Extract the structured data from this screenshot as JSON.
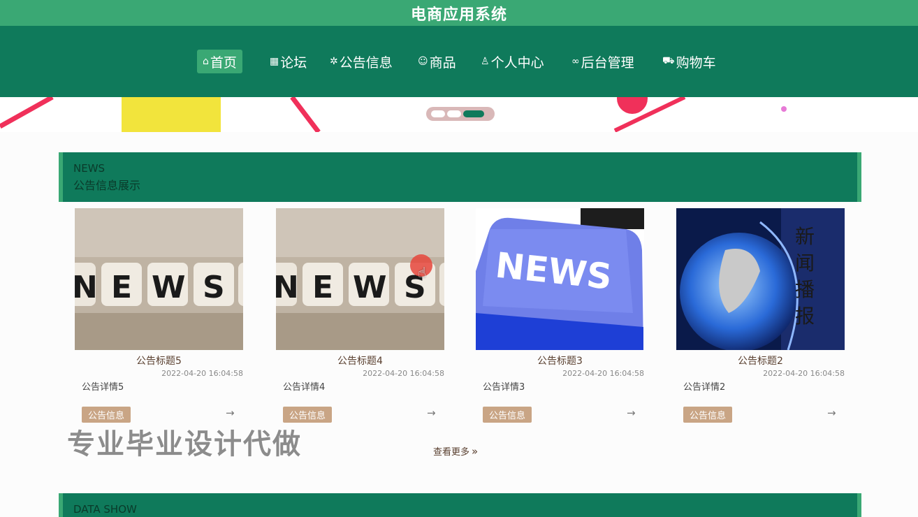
{
  "app": {
    "title": "电商应用系统"
  },
  "nav": {
    "items": [
      {
        "label": "首页",
        "icon": "home-icon"
      },
      {
        "label": "论坛",
        "icon": "forum-icon"
      },
      {
        "label": "公告信息",
        "icon": "notice-icon"
      },
      {
        "label": "商品",
        "icon": "goods-icon"
      },
      {
        "label": "个人中心",
        "icon": "user-icon"
      },
      {
        "label": "后台管理",
        "icon": "link-icon"
      },
      {
        "label": "购物车",
        "icon": "cart-icon"
      }
    ],
    "active_index": 0
  },
  "carousel": {
    "slide_count": 3,
    "active_index": 2
  },
  "news_section": {
    "title_en": "NEWS",
    "title_cn": "公告信息展示",
    "cards": [
      {
        "title": "公告标题5",
        "date": "2022-04-20 16:04:58",
        "detail": "公告详情5",
        "tag": "公告信息",
        "arrow": "→",
        "image": "news-dice-image"
      },
      {
        "title": "公告标题4",
        "date": "2022-04-20 16:04:58",
        "detail": "公告详情4",
        "tag": "公告信息",
        "arrow": "→",
        "image": "news-dice-image"
      },
      {
        "title": "公告标题3",
        "date": "2022-04-20 16:04:58",
        "detail": "公告详情3",
        "tag": "公告信息",
        "arrow": "→",
        "image": "news-keyboard-key-image"
      },
      {
        "title": "公告标题2",
        "date": "2022-04-20 16:04:58",
        "detail": "公告详情2",
        "tag": "公告信息",
        "arrow": "→",
        "image": "news-globe-broadcast-image"
      }
    ],
    "more_label": "查看更多",
    "more_icon": "double-chevron-right-icon"
  },
  "data_section": {
    "title_en": "DATA SHOW"
  },
  "overlay": {
    "watermark": "专业毕业设计代做"
  },
  "colors": {
    "title_bar": "#3aa874",
    "nav": "#0f7a5b",
    "accent": "#3aa874",
    "tag": "#c9a585"
  }
}
